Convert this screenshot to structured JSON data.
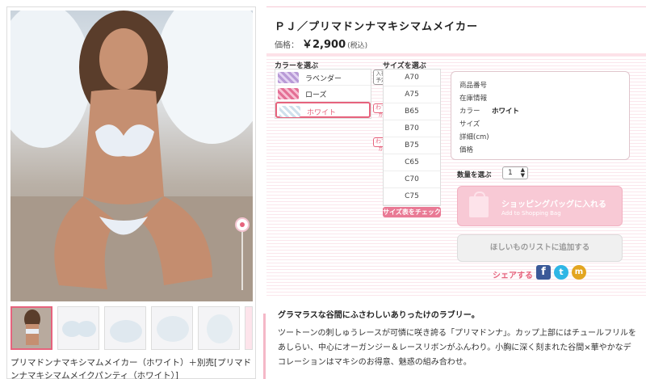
{
  "product": {
    "title": "ＰＪ／プリマドンナマキシマムメイカー",
    "price_label": "価格：",
    "price": "￥2,900",
    "tax_note": "(税込)",
    "caption": "プリマドンナマキシマムメイカー（ホワイト）＋別売[プリマドンナマキシマムメイクパンティ（ホワイト）]"
  },
  "colors": {
    "heading": "カラーを選ぶ",
    "items": [
      {
        "label": "ラベンダー"
      },
      {
        "label": "ローズ"
      },
      {
        "label": "ホワイト",
        "selected": true
      }
    ]
  },
  "sizes": {
    "heading": "サイズを選ぶ",
    "items": [
      "A70",
      "A75",
      "B65",
      "B70",
      "B75",
      "C65",
      "C70",
      "C75"
    ],
    "chart_button": "サイズ表をチェック",
    "badge_restock": "入荷\n予定",
    "badge_few": "わずか"
  },
  "info": {
    "rows": [
      {
        "label": "商品番号",
        "value": ""
      },
      {
        "label": "在庫情報",
        "value": ""
      },
      {
        "label": "カラー",
        "value": "ホワイト"
      },
      {
        "label": "サイズ",
        "value": ""
      },
      {
        "label": "詳細(cm)",
        "value": ""
      },
      {
        "label": "価格",
        "value": ""
      }
    ]
  },
  "quantity": {
    "label": "数量を選ぶ",
    "value": "1"
  },
  "cart": {
    "label": "ショッピングバッグに入れる",
    "sub": "Add to Shopping Bag"
  },
  "wishlist": {
    "label": "ほしいものリストに追加する"
  },
  "share": {
    "label": "シェアする",
    "icons": [
      "facebook-icon",
      "twitter-icon",
      "mixi-icon"
    ]
  },
  "description": {
    "heading": "グラマラスな谷間にふさわしいありったけのラブリー。",
    "body": "ツートーンの刺しゅうレースが可憐に咲き誇る「プリマドンナ」。カップ上部にはチュールフリルをあしらい、中心にオーガンジー＆レースリボンがふんわり。小胸に深く刻まれた谷間×華やかなデコレーションはマキシのお得意、魅惑の組み合わせ。"
  },
  "colors_theme": {
    "accent": "#e6637d",
    "cart_bg": "#f8c9d5"
  }
}
